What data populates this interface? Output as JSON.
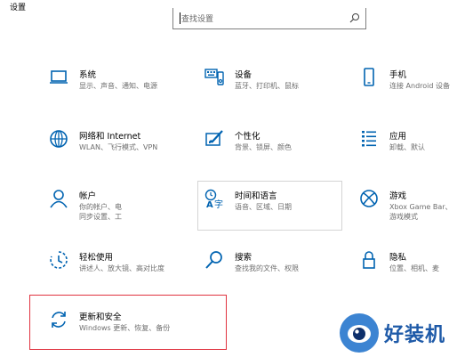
{
  "window": {
    "title": "设置"
  },
  "search": {
    "placeholder": "查找设置"
  },
  "tiles": [
    {
      "id": "system",
      "icon": "laptop-icon",
      "name": "系统",
      "desc": "显示、声音、通知、电源"
    },
    {
      "id": "devices",
      "icon": "keyboard-devices-icon",
      "name": "设备",
      "desc": "蓝牙、打印机、鼠标"
    },
    {
      "id": "phone",
      "icon": "phone-icon",
      "name": "手机",
      "desc_lines": [
        "连接 Android 设备"
      ]
    },
    {
      "id": "network",
      "icon": "globe-icon",
      "name": "网络和 Internet",
      "desc": "WLAN、飞行模式、VPN"
    },
    {
      "id": "personalization",
      "icon": "paint-brush-icon",
      "name": "个性化",
      "desc": "背景、锁屏、颜色"
    },
    {
      "id": "apps",
      "icon": "apps-list-icon",
      "name": "应用",
      "desc_lines": [
        "卸载、默认"
      ]
    },
    {
      "id": "accounts",
      "icon": "person-icon",
      "name": "帐户",
      "desc_lines": [
        "你的帐户、电",
        "同步设置、工"
      ]
    },
    {
      "id": "time-language",
      "icon": "time-language-icon",
      "name": "时间和语言",
      "desc": "语音、区域、日期"
    },
    {
      "id": "gaming",
      "icon": "xbox-icon",
      "name": "游戏",
      "desc_lines": [
        "Xbox Game Bar、",
        "游戏模式"
      ]
    },
    {
      "id": "ease-of-access",
      "icon": "ease-of-access-icon",
      "name": "轻松使用",
      "desc": "讲述人、放大镜、高对比度"
    },
    {
      "id": "search",
      "icon": "search-magnifier-icon",
      "name": "搜索",
      "desc": "查找我的文件、权限"
    },
    {
      "id": "privacy",
      "icon": "lock-icon",
      "name": "隐私",
      "desc_lines": [
        "位置、相机、麦"
      ]
    },
    {
      "id": "update-security",
      "icon": "sync-arrows-icon",
      "name": "更新和安全",
      "desc": "Windows 更新、恢复、备份"
    }
  ],
  "watermark": {
    "text": "好装机"
  },
  "colors": {
    "accent": "#0063b1",
    "highlight": "#e0333f"
  }
}
